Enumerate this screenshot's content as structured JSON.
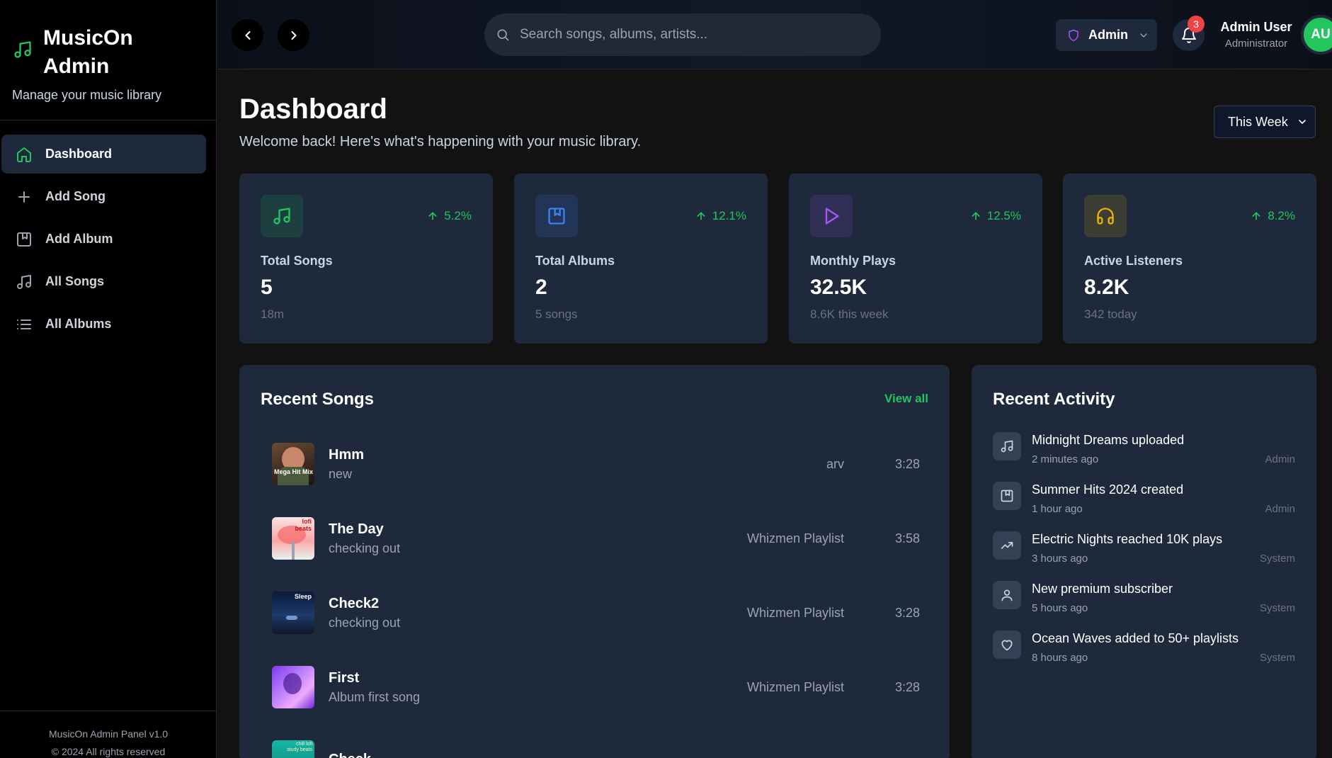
{
  "colors": {
    "accent": "#22c55e",
    "sidebar_bg": "#000000",
    "card_bg": "#1e293b",
    "badge_red": "#ef4444"
  },
  "brand": {
    "title": "MusicOn Admin",
    "subtitle": "Manage your music library",
    "icon": "music-note-icon"
  },
  "nav": [
    {
      "label": "Dashboard",
      "icon": "home-icon",
      "active": true
    },
    {
      "label": "Add Song",
      "icon": "plus-icon",
      "active": false
    },
    {
      "label": "Add Album",
      "icon": "album-icon",
      "active": false
    },
    {
      "label": "All Songs",
      "icon": "music-note-icon",
      "active": false
    },
    {
      "label": "All Albums",
      "icon": "list-icon",
      "active": false
    }
  ],
  "footer": {
    "line1": "MusicOn Admin Panel v1.0",
    "line2": "© 2024 All rights reserved"
  },
  "topbar": {
    "search_placeholder": "Search songs, albums, artists...",
    "role_label": "Admin",
    "notification_count": "3",
    "user_name": "Admin User",
    "user_role": "Administrator",
    "avatar_initials": "AU"
  },
  "page": {
    "title": "Dashboard",
    "subtitle": "Welcome back! Here's what's happening with your music library.",
    "period": "This Week"
  },
  "stats": [
    {
      "label": "Total Songs",
      "value": "5",
      "sub": "18m",
      "change": "5.2%",
      "icon": "music-note-icon",
      "color": "#22c55e"
    },
    {
      "label": "Total Albums",
      "value": "2",
      "sub": "5 songs",
      "change": "12.1%",
      "icon": "album-icon",
      "color": "#3b82f6"
    },
    {
      "label": "Monthly Plays",
      "value": "32.5K",
      "sub": "8.6K this week",
      "change": "12.5%",
      "icon": "play-icon",
      "color": "#a855f7"
    },
    {
      "label": "Active Listeners",
      "value": "8.2K",
      "sub": "342 today",
      "change": "8.2%",
      "icon": "headphones-icon",
      "color": "#eab308"
    }
  ],
  "recent_songs": {
    "title": "Recent Songs",
    "view_all": "View all",
    "items": [
      {
        "title": "Hmm",
        "subtitle": "new",
        "artist": "arv",
        "duration": "3:28",
        "cover_text": "Mega Hit Mix"
      },
      {
        "title": "The Day",
        "subtitle": "checking out",
        "artist": "Whizmen Playlist",
        "duration": "3:58",
        "cover_text": "lofi beats"
      },
      {
        "title": "Check2",
        "subtitle": "checking out",
        "artist": "Whizmen Playlist",
        "duration": "3:28",
        "cover_text": "Sleep"
      },
      {
        "title": "First",
        "subtitle": "Album first song",
        "artist": "Whizmen Playlist",
        "duration": "3:28",
        "cover_text": ""
      },
      {
        "title": "Check",
        "subtitle": "",
        "artist": "",
        "duration": "",
        "cover_text": "chill lofi study beats"
      }
    ]
  },
  "recent_activity": {
    "title": "Recent Activity",
    "items": [
      {
        "title": "Midnight Dreams uploaded",
        "time": "2 minutes ago",
        "by": "Admin",
        "icon": "music-note-icon"
      },
      {
        "title": "Summer Hits 2024 created",
        "time": "1 hour ago",
        "by": "Admin",
        "icon": "album-icon"
      },
      {
        "title": "Electric Nights reached 10K plays",
        "time": "3 hours ago",
        "by": "System",
        "icon": "trending-up-icon"
      },
      {
        "title": "New premium subscriber",
        "time": "5 hours ago",
        "by": "System",
        "icon": "user-icon"
      },
      {
        "title": "Ocean Waves added to 50+ playlists",
        "time": "8 hours ago",
        "by": "System",
        "icon": "heart-icon"
      }
    ]
  }
}
